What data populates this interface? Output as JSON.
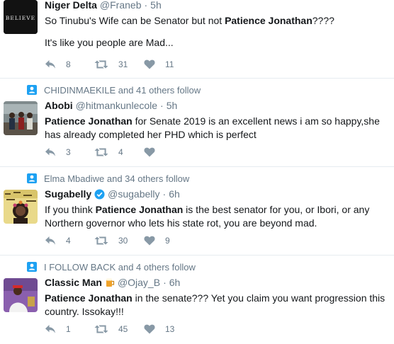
{
  "tweets": [
    {
      "name": "Niger Delta",
      "handle": "@Franeb",
      "separator": "·",
      "time": "5h",
      "line1_pre": "So Tinubu's Wife can be Senator but not ",
      "line1_bold": "Patience Jonathan",
      "line1_post": "????",
      "line2": "It's like you people are Mad...",
      "replies": "8",
      "retweets": "31",
      "likes": "11"
    },
    {
      "context": "CHIDINMAEKILE and 41 others follow",
      "name": "Abobi",
      "handle": "@hitmankunlecole",
      "separator": "·",
      "time": "5h",
      "line1_bold": "Patience Jonathan",
      "line1_post": " for Senate 2019 is an excellent news i am so happy,she",
      "line2": "has already completed her PHD which is perfect",
      "replies": "3",
      "retweets": "4"
    },
    {
      "context": "Elma Mbadiwe and 34 others follow",
      "name": "Sugabelly",
      "handle": "@sugabelly",
      "separator": "·",
      "time": "6h",
      "line1_pre": "If you think ",
      "line1_bold": "Patience Jonathan",
      "line1_post": " is the best senator for you, or Ibori, or any",
      "line2": "Northern governor who lets his state rot, you are beyond mad.",
      "replies": "4",
      "retweets": "30",
      "likes": "9"
    },
    {
      "context": "I FOLLOW BACK and 4 others follow",
      "name": "Classic Man",
      "handle": "@Ojay_B",
      "separator": "·",
      "time": "6h",
      "line1_bold": "Patience Jonathan",
      "line1_post": " in the senate??? Yet you claim you want progression this",
      "line2": "country. Issokay!!!",
      "replies": "1",
      "retweets": "45",
      "likes": "13"
    }
  ],
  "avatar_logo_text": "BELIEVE",
  "colors": {
    "icon": "#8899a6",
    "context_icon": "#1da1f2",
    "verified": "#1da1f2",
    "border": "#e6ecf0"
  }
}
